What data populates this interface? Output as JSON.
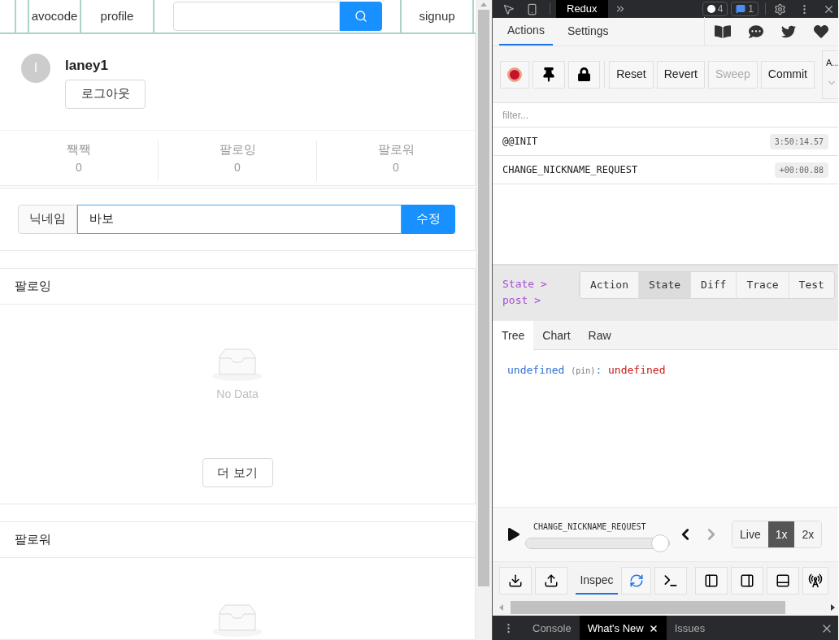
{
  "nav": {
    "items": [
      {
        "kind": "link",
        "label": "avocode"
      },
      {
        "kind": "link",
        "label": "profile"
      },
      {
        "kind": "search"
      },
      {
        "kind": "link",
        "label": "signup"
      }
    ]
  },
  "profile": {
    "avatar": "l",
    "name": "laney1",
    "logout": "로그아웃",
    "stats": [
      {
        "label": "짹짹",
        "value": "0"
      },
      {
        "label": "팔로잉",
        "value": "0"
      },
      {
        "label": "팔로워",
        "value": "0"
      }
    ]
  },
  "nickname_form": {
    "addon": "닉네임",
    "value": "바보",
    "submit": "수정"
  },
  "following": {
    "title": "팔로잉",
    "empty": "No Data",
    "more": "더 보기"
  },
  "followers": {
    "title": "팔로워"
  },
  "devtools": {
    "tabs": [
      {
        "label": "Redux",
        "selected": true
      }
    ],
    "badges": [
      {
        "kind": "errors",
        "count": "4"
      },
      {
        "kind": "messages",
        "count": "1"
      }
    ],
    "monitor_tabs": [
      {
        "label": "Actions",
        "selected": true
      },
      {
        "label": "Settings",
        "selected": false
      }
    ],
    "record": {
      "selected": true
    },
    "buttons": [
      {
        "label": "Reset",
        "disabled": false
      },
      {
        "label": "Revert",
        "disabled": false
      },
      {
        "label": "Sweep",
        "disabled": true
      },
      {
        "label": "Commit",
        "disabled": false
      }
    ],
    "instance": "A...",
    "filter": {
      "placeholder": "filter..."
    },
    "actions": [
      {
        "name": "@@INIT",
        "time": "3:50:14.57"
      },
      {
        "name": "CHANGE_NICKNAME_REQUEST",
        "time": "+00:00.88"
      }
    ],
    "breadcrumb": [
      "State >",
      "post >"
    ],
    "inspector_tabs": [
      {
        "label": "Action",
        "selected": false
      },
      {
        "label": "State",
        "selected": true
      },
      {
        "label": "Diff",
        "selected": false
      },
      {
        "label": "Trace",
        "selected": false
      },
      {
        "label": "Test",
        "selected": false
      }
    ],
    "view_tabs": [
      {
        "label": "Tree",
        "selected": true
      },
      {
        "label": "Chart",
        "selected": false
      },
      {
        "label": "Raw",
        "selected": false
      }
    ],
    "tree": {
      "key": "undefined",
      "hint": "(pin)",
      "separator": ":",
      "value": "undefined"
    },
    "slider": {
      "label": "CHANGE_NICKNAME_REQUEST",
      "level": 1,
      "prev_disabled": false,
      "next_disabled": true
    },
    "speed": [
      {
        "label": "Live",
        "selected": false
      },
      {
        "label": "1x",
        "selected": true
      },
      {
        "label": "2x",
        "selected": false
      }
    ],
    "bottom_tab": "Inspec",
    "drawer_tabs": [
      {
        "label": "Console",
        "selected": false,
        "closable": false
      },
      {
        "label": "What's New",
        "selected": true,
        "closable": true
      },
      {
        "label": "Issues",
        "selected": false,
        "closable": false
      }
    ]
  }
}
